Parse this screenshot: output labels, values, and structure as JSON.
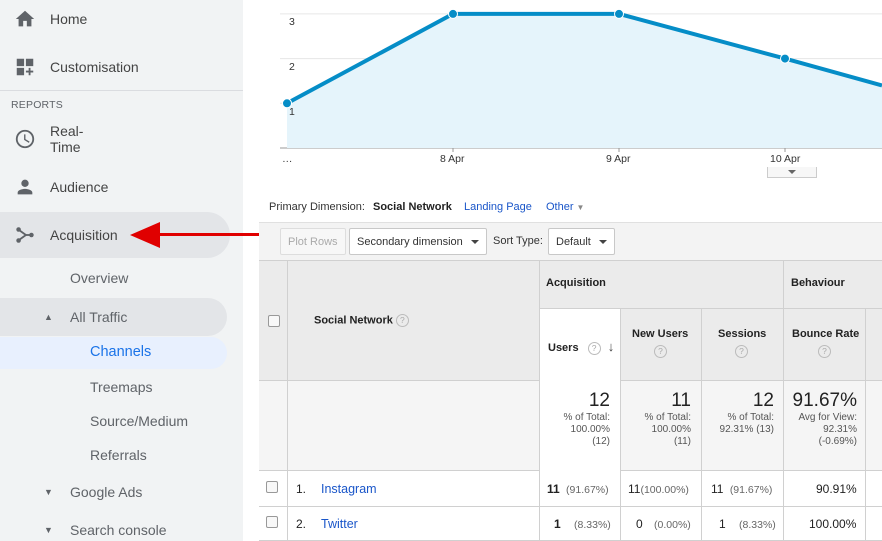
{
  "sidebar": {
    "home": "Home",
    "customisation": "Customisation",
    "reports_label": "REPORTS",
    "realtime": "Real-Time",
    "audience": "Audience",
    "acquisition": "Acquisition",
    "overview": "Overview",
    "all_traffic": "All Traffic",
    "channels": "Channels",
    "treemaps": "Treemaps",
    "source_medium": "Source/Medium",
    "referrals": "Referrals",
    "google_ads": "Google Ads",
    "search_console": "Search console"
  },
  "chart_data": {
    "type": "area",
    "x": [
      "…",
      "8 Apr",
      "9 Apr",
      "10 Apr",
      ""
    ],
    "series": [
      {
        "values": [
          1,
          3,
          3,
          2,
          1.4
        ]
      }
    ],
    "y_ticks": [
      "1",
      "2",
      "3"
    ],
    "x_tick_labels": [
      "…",
      "8 Apr",
      "9 Apr",
      "10 Apr"
    ],
    "ylim": [
      0,
      3.3
    ],
    "grid": true,
    "color": "#058dc7"
  },
  "primary_dimension": {
    "label": "Primary Dimension:",
    "active": "Social Network",
    "link1": "Landing Page",
    "link2": "Other"
  },
  "toolbar": {
    "plot_rows": "Plot Rows",
    "secondary": "Secondary dimension",
    "sort_type_label": "Sort Type:",
    "sort_value": "Default"
  },
  "table": {
    "dimension_header": "Social Network",
    "group_acquisition": "Acquisition",
    "group_behaviour": "Behaviour",
    "col_users": "Users",
    "col_new_users": "New Users",
    "col_sessions": "Sessions",
    "col_bounce": "Bounce Rate",
    "totals": {
      "users": "12",
      "users_sub1": "% of Total:",
      "users_sub2": "100.00%",
      "users_sub3": "(12)",
      "new_users": "11",
      "new_users_sub1": "% of Total:",
      "new_users_sub2": "100.00%",
      "new_users_sub3": "(11)",
      "sessions": "12",
      "sessions_sub1": "% of Total:",
      "sessions_sub2": "92.31% (13)",
      "bounce": "91.67%",
      "bounce_sub1": "Avg for View:",
      "bounce_sub2": "92.31%",
      "bounce_sub3": "(-0.69%)"
    },
    "rows": [
      {
        "index": "1.",
        "name": "Instagram",
        "users": "11",
        "users_pct": "(91.67%)",
        "new_users": "11",
        "new_users_pct": "(100.00%)",
        "sessions": "11",
        "sessions_pct": "(91.67%)",
        "bounce": "90.91%"
      },
      {
        "index": "2.",
        "name": "Twitter",
        "users": "1",
        "users_pct": "(8.33%)",
        "new_users": "0",
        "new_users_pct": "(0.00%)",
        "sessions": "1",
        "sessions_pct": "(8.33%)",
        "bounce": "100.00%"
      }
    ]
  }
}
